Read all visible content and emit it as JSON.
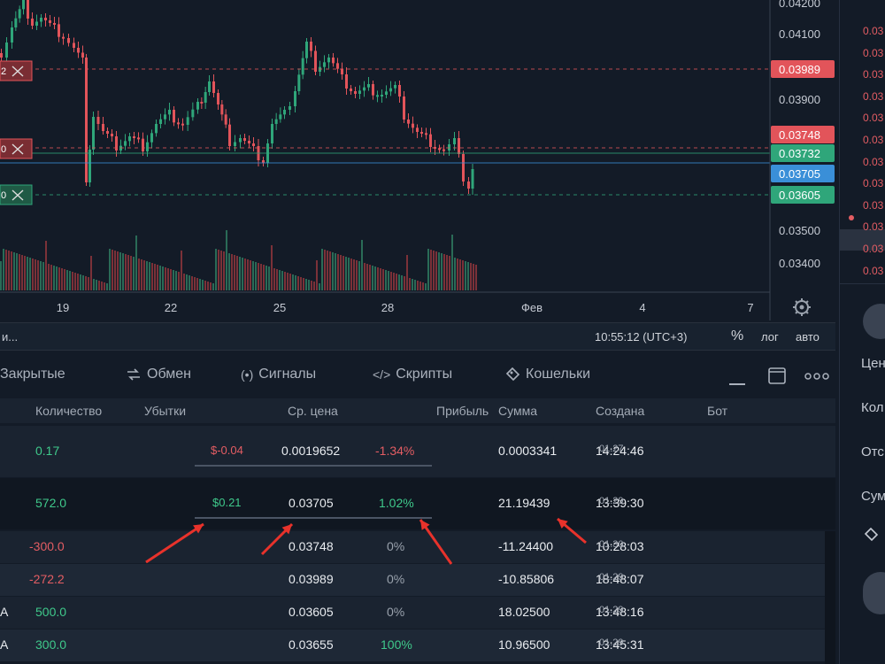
{
  "chart": {
    "price_axis": [
      "0.04200",
      "0.04100",
      "0.03900",
      "0.03500",
      "0.03400"
    ],
    "price_tags": [
      {
        "label": "0.03989",
        "color": "#e2545a"
      },
      {
        "label": "0.03748",
        "color": "#e2545a"
      },
      {
        "label": "0.03732",
        "color": "#2fa67a"
      },
      {
        "label": "0.03705",
        "color": "#3a8fd8"
      },
      {
        "label": "0.03605",
        "color": "#2fa67a"
      }
    ],
    "date_axis": [
      "19",
      "22",
      "25",
      "28",
      "Фев",
      "4",
      "7"
    ],
    "left_line_labels": [
      "2",
      "0",
      "0"
    ]
  },
  "bottom_bar": {
    "truncated_left": "и...",
    "time": "10:55:12 (UTC+3)",
    "percent": "%",
    "log": "лог",
    "auto": "авто"
  },
  "tabs": [
    {
      "label": "Закрытые",
      "icon": ""
    },
    {
      "label": "Обмен",
      "icon": "exchange-icon"
    },
    {
      "label": "Сигналы",
      "icon": "signal-icon"
    },
    {
      "label": "Скрипты",
      "icon": "code-icon"
    },
    {
      "label": "Кошельки",
      "icon": "wallet-icon"
    }
  ],
  "table": {
    "headers": {
      "qty": "Количество",
      "loss": "Убытки",
      "avg": "Ср. цена",
      "profit": "Прибыль",
      "sum": "Сумма",
      "created": "Создана",
      "bot": "Бот"
    },
    "rows": [
      {
        "prefix": "",
        "qty": "0.17",
        "qty_color": "green",
        "pnl": "$-0.04",
        "pnl_color": "red",
        "avg": "0.0019652",
        "pct": "-1.34%",
        "pct_color": "red",
        "sum": "0.0003341",
        "time": "14:24:46",
        "date": "01.27"
      },
      {
        "prefix": "",
        "qty": "572.0",
        "qty_color": "green",
        "pnl": "$0.21",
        "pnl_color": "green",
        "avg": "0.03705",
        "pct": "1.02%",
        "pct_color": "green",
        "sum": "21.19439",
        "time": "13:39:30",
        "date": "01.29"
      },
      {
        "prefix": "",
        "qty": "-300.0",
        "qty_color": "red",
        "pnl": "",
        "pnl_color": "",
        "avg": "0.03748",
        "pct": "0%",
        "pct_color": "dim",
        "sum": "-11.24400",
        "time": "10:28:03",
        "date": "01.30"
      },
      {
        "prefix": "",
        "qty": "-272.2",
        "qty_color": "red",
        "pnl": "",
        "pnl_color": "",
        "avg": "0.03989",
        "pct": "0%",
        "pct_color": "dim",
        "sum": "-10.85806",
        "time": "18:48:07",
        "date": "01.29"
      },
      {
        "prefix": "A",
        "qty": "500.0",
        "qty_color": "green",
        "pnl": "",
        "pnl_color": "",
        "avg": "0.03605",
        "pct": "0%",
        "pct_color": "dim",
        "sum": "18.02500",
        "time": "13:48:16",
        "date": "01.29"
      },
      {
        "prefix": "A",
        "qty": "300.0",
        "qty_color": "green",
        "pnl": "",
        "pnl_color": "",
        "avg": "0.03655",
        "pct": "100%",
        "pct_color": "green",
        "sum": "10.96500",
        "time": "13:45:31",
        "date": "01.29"
      }
    ]
  },
  "side_panel": {
    "orders": [
      "0.03",
      "0.03",
      "0.03",
      "0.03",
      "0.03",
      "0.03",
      "0.03",
      "0.03",
      "0.03",
      "0.03",
      "0.03",
      "0.03"
    ],
    "labels": [
      "Цен",
      "Кол",
      "Отс",
      "Сум"
    ]
  },
  "colors": {
    "up": "#2fa67a",
    "down": "#e2545a",
    "accent": "#3a8fd8"
  }
}
